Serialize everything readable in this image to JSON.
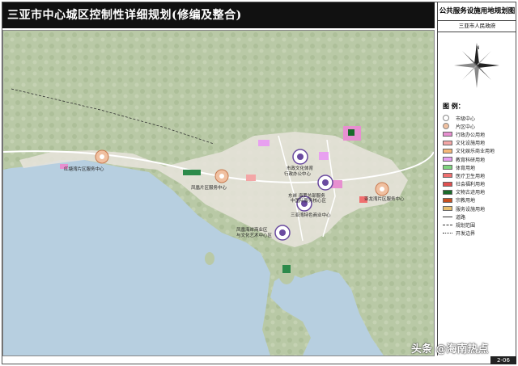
{
  "title": "三亚市中心城区控制性详细规划(修编及整合)",
  "sidebar": {
    "map_title": "公共服务设施用地规划图",
    "org": "三亚市人民政府"
  },
  "legend": {
    "heading": "图 例：",
    "items": [
      {
        "label": "市级中心",
        "color": "#ffffff",
        "style": "circle-outline"
      },
      {
        "label": "片区中心",
        "color": "#f0c0a0",
        "style": "circle-outline"
      },
      {
        "label": "行政办公用地",
        "color": "#e78fd0",
        "style": "fill"
      },
      {
        "label": "文化设施用地",
        "color": "#f3a6a6",
        "style": "fill"
      },
      {
        "label": "文化娱乐商业用地",
        "color": "#f6b878",
        "style": "fill"
      },
      {
        "label": "教育科研用地",
        "color": "#e8a0f0",
        "style": "fill"
      },
      {
        "label": "体育用地",
        "color": "#7fd47f",
        "style": "fill"
      },
      {
        "label": "医疗卫生用地",
        "color": "#f07070",
        "style": "fill"
      },
      {
        "label": "社会福利用地",
        "color": "#e05050",
        "style": "fill"
      },
      {
        "label": "文物古迹用地",
        "color": "#1a6a2a",
        "style": "fill"
      },
      {
        "label": "宗教用地",
        "color": "#c85020",
        "style": "fill"
      },
      {
        "label": "服务设施用地",
        "color": "#e8c070",
        "style": "fill"
      },
      {
        "label": "道路",
        "color": "#333333",
        "style": "line"
      },
      {
        "label": "规划范围",
        "color": "#333333",
        "style": "dash"
      },
      {
        "label": "开发边界",
        "color": "#333333",
        "style": "dashdot"
      }
    ]
  },
  "map_labels": {
    "l1": "红塘湾片区服务中心",
    "l2": "凤凰片区服务中心",
    "l3": "市政文化体育",
    "l3b": "行政办公中心",
    "l4": "东岸 海罗总部服务",
    "l4b": "中国际服务核心区",
    "l5": "三亚湾特色商业中心",
    "l6": "凤凰海岸商业区",
    "l6b": "与文化艺术中心区",
    "l7": "亚龙湾片区服务中心"
  },
  "page_number": "2-06",
  "watermark": "头条 @海南热点"
}
